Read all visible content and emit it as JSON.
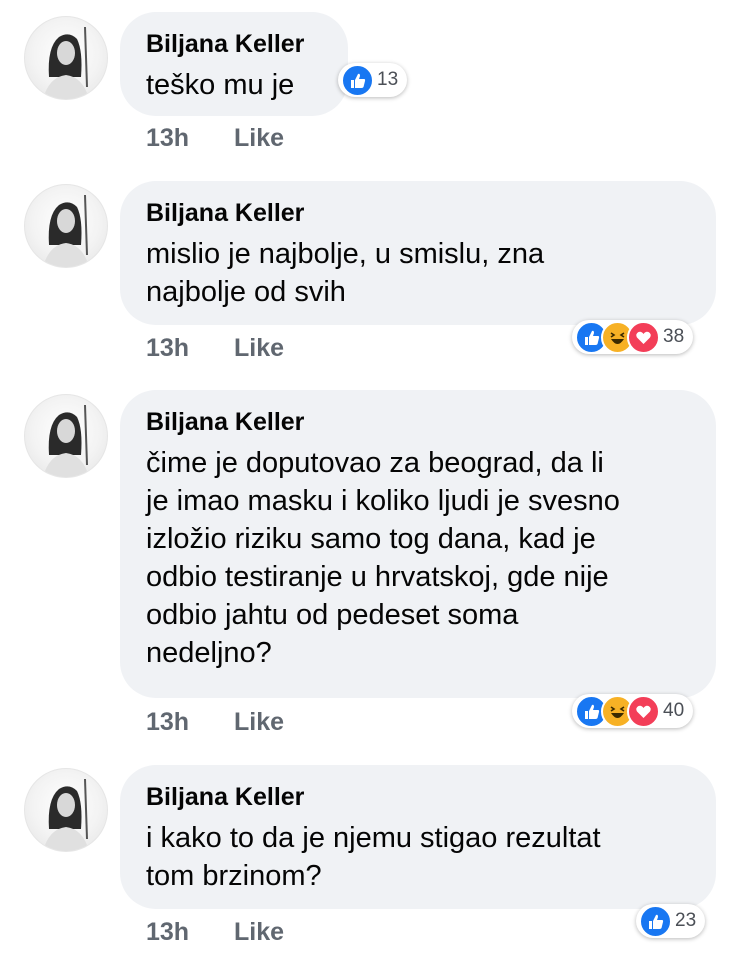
{
  "colors": {
    "like_blue": "#1877f2",
    "haha_yellow": "#f7b125",
    "love_red": "#f33e58",
    "bubble_bg": "#f0f2f5",
    "meta_gray": "#606770"
  },
  "comments": [
    {
      "author": "Biljana Keller",
      "lines": [
        "teško mu je"
      ],
      "time": "13h",
      "like_label": "Like",
      "reactions": [
        "like-icon"
      ],
      "reaction_count": "13"
    },
    {
      "author": "Biljana Keller",
      "lines": [
        "mislio je najbolje, u smislu, zna",
        "najbolje od svih"
      ],
      "time": "13h",
      "like_label": "Like",
      "reactions": [
        "like-icon",
        "haha-icon",
        "love-icon"
      ],
      "reaction_count": "38"
    },
    {
      "author": "Biljana Keller",
      "lines": [
        "čime je doputovao za beograd, da li",
        "je imao masku i koliko ljudi je svesno",
        "izložio riziku samo tog dana, kad je",
        "odbio testiranje u hrvatskoj, gde nije",
        "odbio jahtu od pedeset soma",
        "nedeljno?"
      ],
      "time": "13h",
      "like_label": "Like",
      "reactions": [
        "like-icon",
        "haha-icon",
        "love-icon"
      ],
      "reaction_count": "40"
    },
    {
      "author": "Biljana Keller",
      "lines": [
        "i kako to da je njemu stigao rezultat",
        "tom brzinom?"
      ],
      "time": "13h",
      "like_label": "Like",
      "reactions": [
        "like-icon"
      ],
      "reaction_count": "23"
    }
  ]
}
